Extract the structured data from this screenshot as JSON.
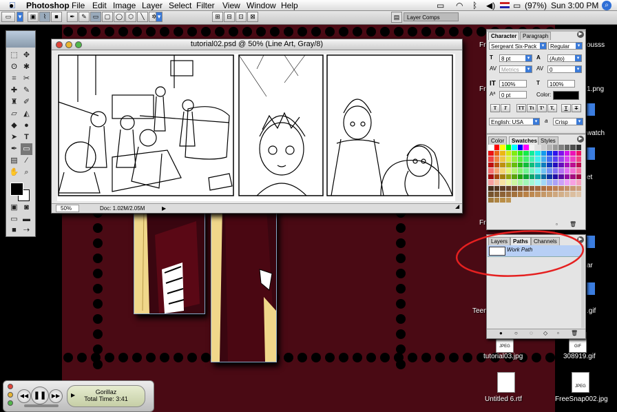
{
  "menubar": {
    "app_name": "Photoshop",
    "items": [
      "File",
      "Edit",
      "Image",
      "Layer",
      "Select",
      "Filter",
      "View",
      "Window",
      "Help"
    ],
    "battery": "(97%)",
    "clock": "Sun 3:00 PM"
  },
  "optbar": {
    "layer_comps_label": "Layer Comps"
  },
  "document": {
    "title": "tutorial02.psd @ 50% (Line Art, Gray/8)",
    "zoom": "50%",
    "doc_size": "Doc: 1.02M/2.05M"
  },
  "character_palette": {
    "tabs": [
      "Character",
      "Paragraph"
    ],
    "font_family": "Sergeant Six-Pack",
    "font_style": "Regular",
    "font_size": "8 pt",
    "leading": "(Auto)",
    "kerning": "Metrics",
    "tracking": "0",
    "vertical_scale": "100%",
    "horizontal_scale": "100%",
    "baseline_shift": "0 pt",
    "color_label": "Color:",
    "style_buttons": [
      "T",
      "T",
      "TT",
      "Tt",
      "T¹",
      "T,",
      "T",
      "T"
    ],
    "language": "English: USA",
    "aa_label": "a",
    "antialias": "Crisp"
  },
  "swatches_palette": {
    "tabs": [
      "Color",
      "Swatches",
      "Styles"
    ],
    "colors": [
      "#ffffff",
      "#ff0000",
      "#ffff00",
      "#00ff00",
      "#00ffff",
      "#0000ff",
      "#ff00ff",
      "#f2f2f2",
      "#e0e0e0",
      "#cccccc",
      "#b3b3b3",
      "#999999",
      "#808080",
      "#666666",
      "#4d4d4d",
      "#333333"
    ]
  },
  "layers_palette": {
    "tabs": [
      "Layers",
      "Paths",
      "Channels"
    ],
    "rows": [
      {
        "name": "Work Path"
      }
    ]
  },
  "desktop_icons": [
    {
      "label": "tutorial03.jpg"
    },
    {
      "label": "308919.gif"
    },
    {
      "label": "Untitled 6.rtf"
    },
    {
      "label": "FreeSnap002.jpg"
    }
  ],
  "desktop_partial_labels": {
    "ousss": "ousss",
    "fre1": "Fre",
    "fre2": "Fre",
    "watch": "watch",
    "et": "et",
    "fre3": "Fre",
    "ar": "ar",
    "teen": "Teen",
    "gif": ".gif",
    "dot1": "1.png"
  },
  "itunes": {
    "track": "Gorillaz",
    "total_time": "Total Time: 3:41"
  },
  "colors": {
    "desktop_bg": "#4a0a14",
    "selection_blue": "#b7cff5",
    "annotation_red": "#e52020"
  }
}
